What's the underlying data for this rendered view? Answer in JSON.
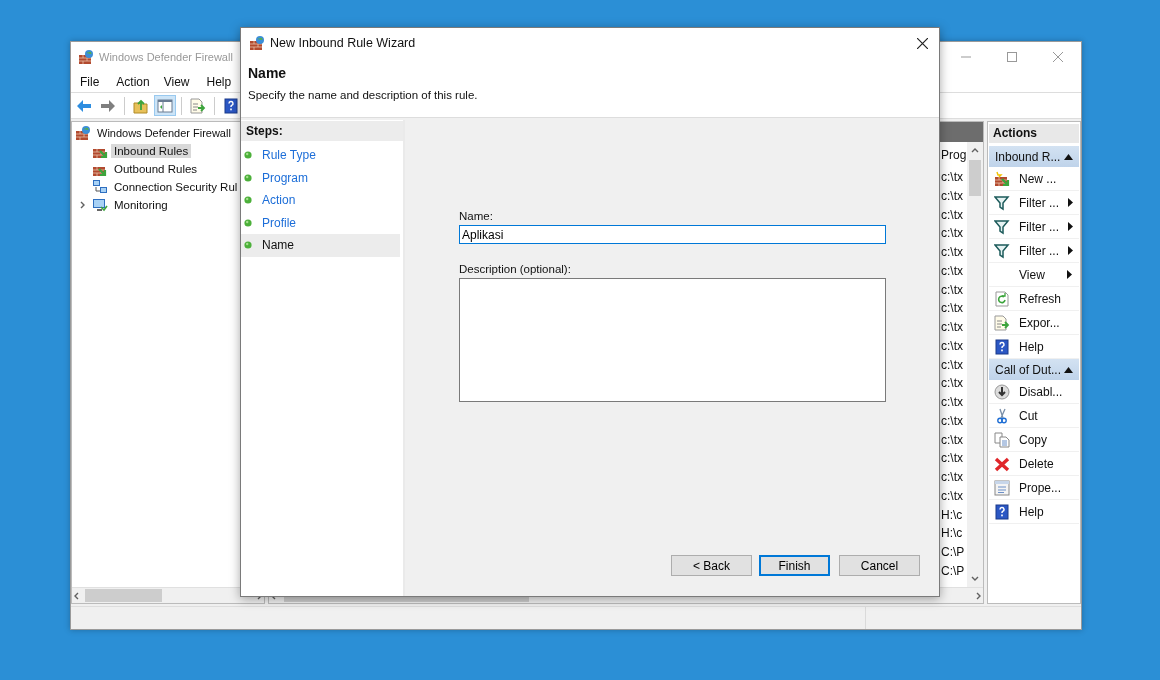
{
  "main_window": {
    "title": "Windows Defender Firewall",
    "menu": [
      "File",
      "Action",
      "View",
      "Help"
    ],
    "toolbar": [
      {
        "selected": false
      },
      {
        "selected": false
      },
      {
        "selected": false
      },
      {
        "selected": true
      },
      {
        "selected": false
      },
      {
        "selected": false
      }
    ],
    "tree": {
      "label": "Windows Defender Firewall",
      "selected": false,
      "children": [
        {
          "label": "Inbound Rules",
          "selected": true
        },
        {
          "label": "Outbound Rules",
          "selected": false
        },
        {
          "label": "Connection Security Rul",
          "selected": false
        },
        {
          "label": "Monitoring",
          "selected": false,
          "expanded": false
        }
      ]
    },
    "list": {
      "column_1": "Prog",
      "rows": [
        "c:\\tx",
        "c:\\tx",
        "c:\\tx",
        "c:\\tx",
        "c:\\tx",
        "c:\\tx",
        "c:\\tx",
        "c:\\tx",
        "c:\\tx",
        "c:\\tx",
        "c:\\tx",
        "c:\\tx",
        "c:\\tx",
        "c:\\tx",
        "c:\\tx",
        "c:\\tx",
        "c:\\tx",
        "c:\\tx",
        "H:\\c",
        "H:\\c",
        "C:\\P",
        "C:\\P"
      ]
    },
    "actions": {
      "title": "Actions",
      "sections": [
        {
          "title": "Inbound R...",
          "expanded": true,
          "items": [
            {
              "label": "New ...",
              "submenu": false
            },
            {
              "label": "Filter ...",
              "submenu": true
            },
            {
              "label": "Filter ...",
              "submenu": true
            },
            {
              "label": "Filter ...",
              "submenu": true
            },
            {
              "label": "View",
              "submenu": true
            },
            {
              "label": "Refresh",
              "submenu": false
            },
            {
              "label": "Expor...",
              "submenu": false
            },
            {
              "label": "Help",
              "submenu": false
            }
          ]
        },
        {
          "title": "Call of Dut...",
          "expanded": true,
          "items": [
            {
              "label": "Disabl...",
              "submenu": false
            },
            {
              "label": "Cut",
              "submenu": false
            },
            {
              "label": "Copy",
              "submenu": false
            },
            {
              "label": "Delete",
              "submenu": false
            },
            {
              "label": "Prope...",
              "submenu": false
            },
            {
              "label": "Help",
              "submenu": false
            }
          ]
        }
      ]
    }
  },
  "dialog": {
    "title": "New Inbound Rule Wizard",
    "heading": "Name",
    "subheading": "Specify the name and description of this rule.",
    "steps_title": "Steps:",
    "steps": [
      {
        "label": "Rule Type",
        "selected": false
      },
      {
        "label": "Program",
        "selected": false
      },
      {
        "label": "Action",
        "selected": false
      },
      {
        "label": "Profile",
        "selected": false
      },
      {
        "label": "Name",
        "selected": true
      }
    ],
    "name_field": {
      "label": "Name:",
      "value": "Aplikasi",
      "focused": true
    },
    "description_field": {
      "label": "Description (optional):"
    },
    "buttons": [
      {
        "label": "< Back",
        "default": false
      },
      {
        "label": "Finish",
        "default": true
      },
      {
        "label": "Cancel",
        "default": false
      }
    ]
  }
}
